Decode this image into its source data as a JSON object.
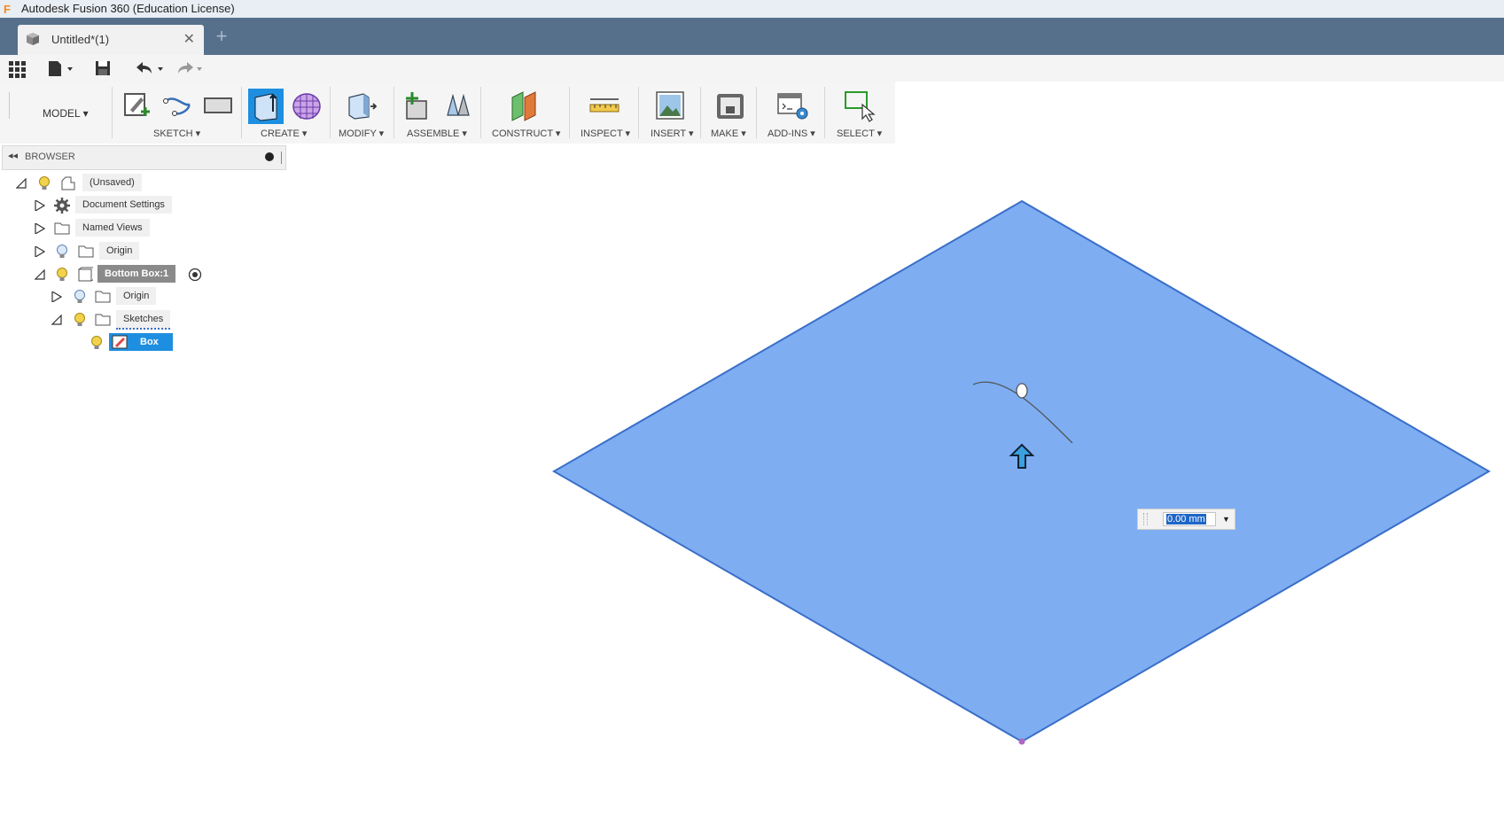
{
  "window": {
    "title": "Autodesk Fusion 360 (Education License)",
    "app_icon": "fusion-logo-icon"
  },
  "tabs": {
    "document_title": "Untitled*(1)",
    "close_glyph": "✕",
    "new_tab_glyph": "+"
  },
  "ribbon": {
    "mode": "MODEL ▾",
    "groups": {
      "sketch": "SKETCH ▾",
      "create": "CREATE ▾",
      "modify": "MODIFY ▾",
      "assemble": "ASSEMBLE ▾",
      "construct": "CONSTRUCT ▾",
      "inspect": "INSPECT ▾",
      "insert": "INSERT ▾",
      "make": "MAKE ▾",
      "addins": "ADD-INS ▾",
      "select": "SELECT ▾"
    }
  },
  "browser": {
    "title": "BROWSER",
    "collapse_glyph": "◂◂",
    "nodes": {
      "root": "(Unsaved)",
      "document_settings": "Document Settings",
      "named_views": "Named Views",
      "origin": "Origin",
      "bottom_box": "Bottom Box:1",
      "sub_origin": "Origin",
      "sketches": "Sketches",
      "box": "Box"
    }
  },
  "viewport": {
    "dimension_value": "0.00 mm",
    "face_color": "#7eadf2",
    "edge_color": "#3a6fc8",
    "arrow_color": "#3aa0e0"
  },
  "colors": {
    "tab_bar": "#56708c",
    "selection": "#1e8fe0"
  }
}
